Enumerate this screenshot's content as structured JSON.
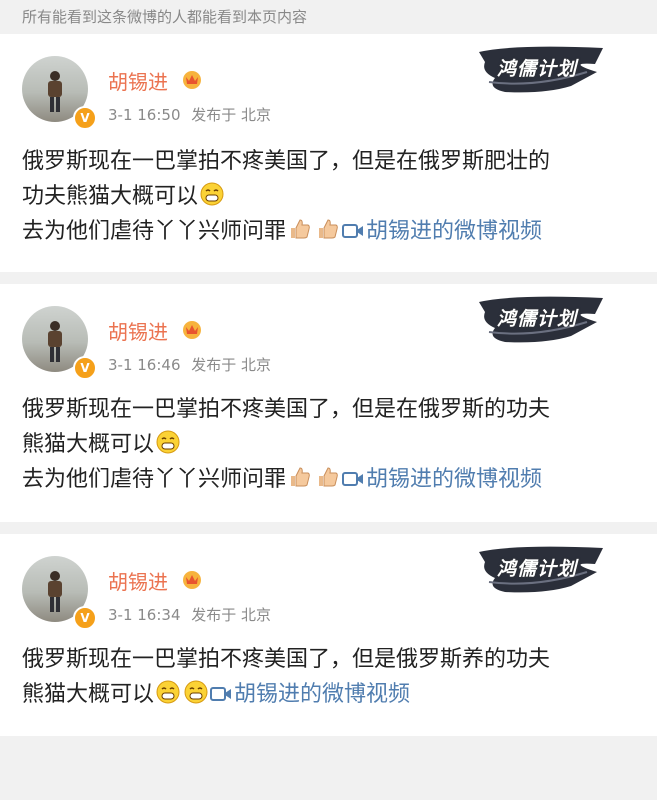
{
  "header": {
    "notice": "所有能看到这条微博的人都能看到本页内容"
  },
  "brand": {
    "text": "鸿儒计划"
  },
  "posts": [
    {
      "author": "胡锡进",
      "time": "3-1 16:50",
      "source": "发布于 北京",
      "lines": [
        "俄罗斯现在一巴掌拍不疼美国了，但是在俄罗斯肥壮的",
        "功夫熊猫大概可以",
        "去为他们虐待丫丫兴师问罪"
      ],
      "video_link": "胡锡进的微博视频"
    },
    {
      "author": "胡锡进",
      "time": "3-1 16:46",
      "source": "发布于 北京",
      "lines": [
        "俄罗斯现在一巴掌拍不疼美国了，但是在俄罗斯的功夫",
        "熊猫大概可以",
        "去为他们虐待丫丫兴师问罪"
      ],
      "video_link": "胡锡进的微博视频"
    },
    {
      "author": "胡锡进",
      "time": "3-1 16:34",
      "source": "发布于 北京",
      "lines": [
        "俄罗斯现在一巴掌拍不疼美国了，但是俄罗斯养的功夫",
        "熊猫大概可以"
      ],
      "video_link": "胡锡进的微博视频"
    }
  ],
  "colors": {
    "name": "#eb7350",
    "link": "#507daf",
    "meta": "#8a8a8a",
    "text": "#222222",
    "badge": "#f5a01a"
  },
  "icons": [
    "verified-badge-icon",
    "member-crown-icon",
    "grin-emoji-icon",
    "thumbs-up-emoji-icon",
    "video-icon"
  ]
}
